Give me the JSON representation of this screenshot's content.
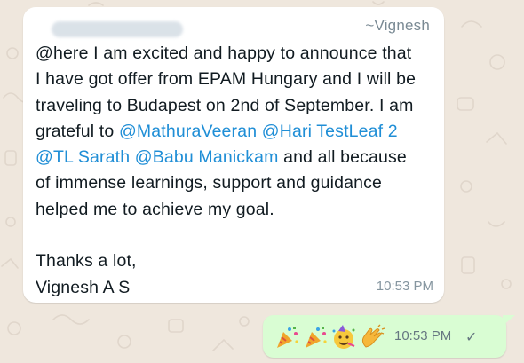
{
  "incoming_message": {
    "sender_name": "~Vignesh",
    "segments": [
      {
        "text": "@here I am excited and happy to announce that\nI have got offer from EPAM Hungary and I will be\ntraveling to Budapest on 2nd of September. I am\ngrateful to ",
        "type": "plain"
      },
      {
        "text": "@MathuraVeeran",
        "type": "mention"
      },
      {
        "text": " ",
        "type": "plain"
      },
      {
        "text": "@Hari TestLeaf 2",
        "type": "mention"
      },
      {
        "text": "\n",
        "type": "plain"
      },
      {
        "text": "@TL Sarath",
        "type": "mention"
      },
      {
        "text": " ",
        "type": "plain"
      },
      {
        "text": "@Babu Manickam",
        "type": "mention"
      },
      {
        "text": " and all because\nof immense learnings, support and guidance\nhelped me to achieve my goal.\n\nThanks a lot,\nVignesh A S",
        "type": "plain"
      }
    ],
    "time": "10:53 PM"
  },
  "outgoing_message": {
    "emojis": [
      "party-popper-icon",
      "party-popper-icon",
      "partying-face-icon",
      "clapping-hands-icon"
    ],
    "time": "10:53 PM",
    "status": "✓"
  },
  "colors": {
    "background": "#efe7dd",
    "incoming_bubble": "#ffffff",
    "outgoing_bubble": "#d9fdd3",
    "mention": "#1f8ed6",
    "text": "#111b21",
    "meta": "#8696a0"
  }
}
